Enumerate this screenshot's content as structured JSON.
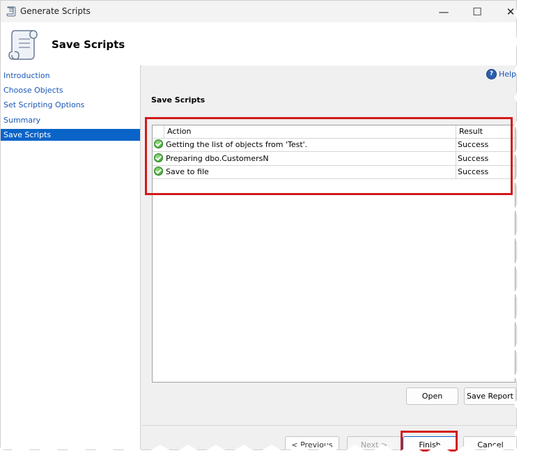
{
  "window": {
    "title": "Generate Scripts",
    "controls": {
      "minimize": "—",
      "maximize": "☐",
      "close": "✕"
    }
  },
  "header": {
    "title": "Save Scripts"
  },
  "nav": {
    "items": [
      {
        "label": "Introduction",
        "active": false
      },
      {
        "label": "Choose Objects",
        "active": false
      },
      {
        "label": "Set Scripting Options",
        "active": false
      },
      {
        "label": "Summary",
        "active": false
      },
      {
        "label": "Save Scripts",
        "active": true
      }
    ]
  },
  "content": {
    "help_label": "Help",
    "section_title": "Save Scripts",
    "grid": {
      "columns": [
        "Action",
        "Result"
      ],
      "rows": [
        {
          "action": "Getting the list of objects from 'Test'.",
          "result": "Success",
          "icon": "success-check-icon"
        },
        {
          "action": "Preparing dbo.CustomersN",
          "result": "Success",
          "icon": "success-check-icon"
        },
        {
          "action": "Save to file",
          "result": "Success",
          "icon": "success-check-icon"
        }
      ]
    },
    "buttons": {
      "open": "Open",
      "save_report": "Save Report"
    }
  },
  "footer": {
    "previous": "< Previous",
    "next": "Next >",
    "finish": "Finish",
    "cancel": "Cancel"
  },
  "colors": {
    "highlight": "#d21a1a",
    "nav_active": "#0a64c8",
    "link": "#1a57b6",
    "success": "#2f9d26"
  }
}
